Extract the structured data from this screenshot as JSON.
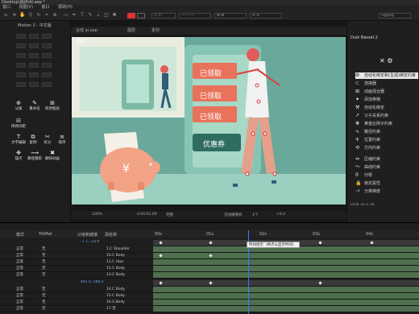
{
  "window": {
    "title": "Desktop\\调研\\AI.aep *"
  },
  "menu": [
    "窗口",
    "视图(V)",
    "窗口",
    "帮助(H)"
  ],
  "toolbar": {
    "search_box": "rigging",
    "right_box": "□"
  },
  "left_panel": {
    "title": "Motion 3 - 中文版",
    "buttons": [
      {
        "label": "父级",
        "icon": "⊕"
      },
      {
        "label": "重命名",
        "icon": "✎"
      },
      {
        "label": "修改图层",
        "icon": "⊞"
      },
      {
        "label": "修改间距",
        "icon": "⊟"
      },
      {
        "label": "文字编辑",
        "icon": "T"
      },
      {
        "label": "复制",
        "icon": "⧉"
      },
      {
        "label": "拆分",
        "icon": "✂"
      },
      {
        "label": "排序",
        "icon": "≡"
      },
      {
        "label": "锚点",
        "icon": "✥"
      },
      {
        "label": "路径跟踪",
        "icon": "⟿"
      },
      {
        "label": "删除动画",
        "icon": "✖"
      }
    ]
  },
  "viewer": {
    "tabs": [
      "合成 ai.aep",
      "图层",
      "素材"
    ],
    "canvas_label": "(图版)",
    "labels": [
      "已领取",
      "已领取",
      "已领取"
    ],
    "coupon": "优惠券",
    "yen": "¥"
  },
  "viewer_bar": {
    "zoom": "100%",
    "timecode": "0:00:01:00",
    "quality": "完整",
    "camera": "活动摄像机",
    "views": "1个",
    "offset": "+0.0"
  },
  "right_panel": {
    "title": "Duik Bassel.2",
    "version": "DuIK 16.2.28",
    "items": [
      {
        "label": "自动化绑定和(生成)绑定约束",
        "icon": "⚙",
        "highlight": true
      },
      {
        "label": "连接器",
        "icon": "⊂"
      },
      {
        "label": "动画混合器",
        "icon": "⊞"
      },
      {
        "label": "添加骨骼",
        "icon": "✦"
      },
      {
        "label": "自动化绑定",
        "icon": "⚒"
      },
      {
        "label": "父子关系约束",
        "icon": "↗"
      },
      {
        "label": "黄金比例子约束",
        "icon": "❋"
      },
      {
        "label": "路径约束",
        "icon": "∿"
      },
      {
        "label": "位置约束",
        "icon": "✛"
      },
      {
        "label": "方向约束",
        "icon": "⟲"
      },
      {
        "label": "压缩约束",
        "icon": "⇔"
      },
      {
        "label": "曲线约束",
        "icon": "〜"
      },
      {
        "label": "归零",
        "icon": "0"
      },
      {
        "label": "锁定属性",
        "icon": "🔒"
      },
      {
        "label": "分离维度",
        "icon": "⊣"
      }
    ]
  },
  "timeline": {
    "header_cols": [
      "源名称",
      "父级和链接",
      "模式",
      "TrkMat"
    ],
    "time_marks": [
      "00s",
      "01s",
      "02s",
      "03s",
      "04s"
    ],
    "layers": [
      {
        "mode": "正常",
        "trk": "无",
        "parent": "1.C Shoulder"
      },
      {
        "mode": "正常",
        "trk": "无",
        "parent": "10.C Body"
      },
      {
        "mode": "正常",
        "trk": "无",
        "parent": "11.C Hips"
      },
      {
        "mode": "正常",
        "trk": "无",
        "parent": "12.C Body"
      },
      {
        "mode": "正常",
        "trk": "无",
        "parent": "13.C Body"
      },
      {
        "mode": "正常",
        "trk": "无",
        "parent": "14.C Body"
      },
      {
        "mode": "正常",
        "trk": "无",
        "parent": "15.C Body"
      },
      {
        "mode": "正常",
        "trk": "无",
        "parent": "16.S.Body"
      },
      {
        "mode": "正常",
        "trk": "无",
        "parent": "17.无"
      }
    ],
    "value_a": "-7.7, -33.9",
    "value_b": "491.5, 566.5",
    "tooltip": "时间指示（将点以显示时间）"
  },
  "colors": {
    "accent": "#2a7fff",
    "canvas_bg": "#6aa89b",
    "label_red": "#e8725a",
    "track_green": "#4f6f4f"
  }
}
